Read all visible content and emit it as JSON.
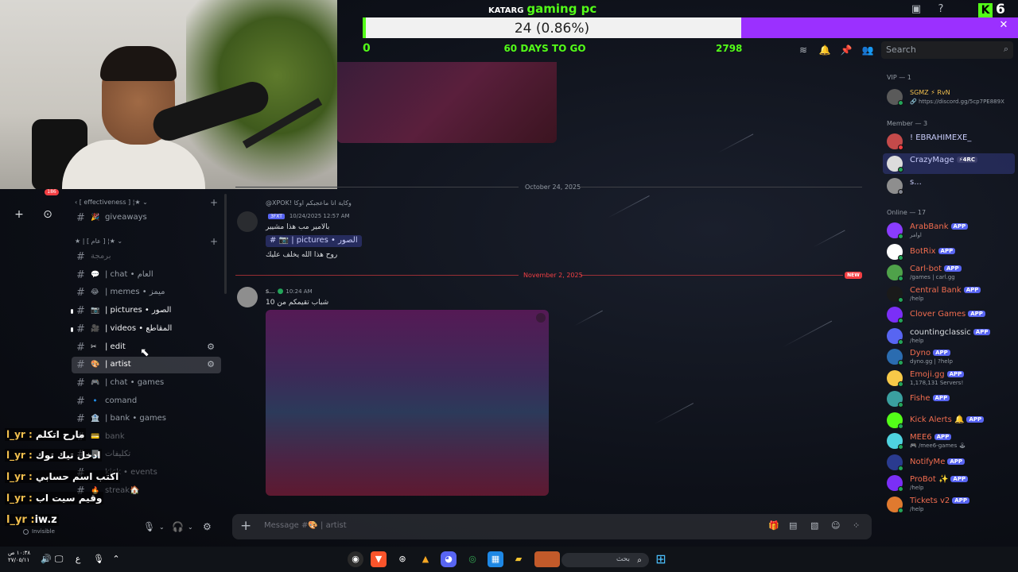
{
  "goal": {
    "brand": "KATARG",
    "title": "gaming pc",
    "bar_text": "24 (0.86%)",
    "progress_fraction": 0.0086,
    "min": "0",
    "days_left": "60 DAYS TO GO",
    "max": "2798",
    "kick_count": "6",
    "kick_logo": "K"
  },
  "header": {
    "search_placeholder": "Search"
  },
  "live_badge": "186",
  "channels": {
    "cat1": "‹ [ effectiveness ] ¦★ ⌄",
    "cat2": "★ | [ عام ] ¦★ ⌄",
    "items": [
      {
        "emoji": "🎉",
        "label": "giveaways"
      },
      {
        "emoji": "",
        "label": "برمجة"
      },
      {
        "emoji": "💬",
        "label": "| chat • العام"
      },
      {
        "emoji": "😂",
        "label": "| memes • ميمز"
      },
      {
        "emoji": "📷",
        "label": "| pictures • الصور"
      },
      {
        "emoji": "🎥",
        "label": "| videos • المقاطع"
      },
      {
        "emoji": "✂",
        "label": "| edit"
      },
      {
        "emoji": "🎨",
        "label": "| artist"
      },
      {
        "emoji": "🎮",
        "label": "| chat • games"
      },
      {
        "emoji": "🔹",
        "label": "comand"
      },
      {
        "emoji": "🏦",
        "label": "| bank • games"
      },
      {
        "emoji": "💳",
        "label": "bank"
      },
      {
        "emoji": "📃",
        "label": "تكليفات"
      },
      {
        "emoji": "",
        "label": "kick • events"
      },
      {
        "emoji": "🔥",
        "label": "streak🏠"
      }
    ]
  },
  "chat_overlay": [
    {
      "user": "l_yr :",
      "msg": "مارح اتكلم"
    },
    {
      "user": "l_yr :",
      "msg": "ادخل تيك توك"
    },
    {
      "user": "l_yr :",
      "msg": "اكتب اسم حسابي"
    },
    {
      "user": "l_yr :",
      "msg": "وقيم سيت اب"
    }
  ],
  "user_panel": {
    "name_user": "l_yr :",
    "name_value": "iw.z",
    "status": "Invisible"
  },
  "messages": {
    "date1": "October 24, 2025",
    "date2": "November 2, 2025",
    "new_label": "NEW",
    "m1_reply": "@XPOK! وكاية انا ماعجبكم اوكا",
    "m1_tag": "3FXT",
    "m1_time": "10/24/2025 12:57 AM",
    "m1_line1": "بالامير مب هذا مشيير",
    "m1_chip": "# 📷 | pictures • الصور",
    "m1_line2": "روح هذا الله يخلف عليك",
    "m2_name": "s...",
    "m2_time": "10:24 AM",
    "m2_text": "شباب تقيمكم من 10"
  },
  "composer": {
    "placeholder": "Message #🎨 | artist"
  },
  "members": {
    "vip_header": "VIP — 1",
    "member_header": "Member — 3",
    "online_header": "Online — 17",
    "vip": [
      {
        "name": "SGMZ ⚡ RvN",
        "sub": "🔗 https://discord.gg/5cp7PE889X",
        "color": "#f2c04e"
      }
    ],
    "member": [
      {
        "name": "! EBRAHIMEXE_",
        "sub": "",
        "color": "#c9cdfb"
      },
      {
        "name": "CrazyMage",
        "badge": "⚡4RC",
        "sub": "",
        "color": "#c9cdfb"
      },
      {
        "name": "s...",
        "sub": "",
        "color": "#c9cdfb"
      }
    ],
    "online": [
      {
        "name": "ArabBank",
        "sub": "اوامر",
        "color": "#f26d4f",
        "av": "#8a3cff"
      },
      {
        "name": "BotRix",
        "sub": "",
        "color": "#f26d4f",
        "av": "#ffffff"
      },
      {
        "name": "Carl-bot",
        "sub": "/games | carl.gg",
        "color": "#f26d4f",
        "av": "#4fa24a"
      },
      {
        "name": "Central Bank",
        "sub": "/help",
        "color": "#f26d4f",
        "av": "#1a1a1a"
      },
      {
        "name": "Clover Games",
        "sub": "",
        "color": "#f26d4f",
        "av": "#7b2ff7"
      },
      {
        "name": "countingclassic",
        "sub": "/help",
        "color": "#dbdee1",
        "av": "#5865f2"
      },
      {
        "name": "Dyno",
        "sub": "dyno.gg | ?help",
        "color": "#f26d4f",
        "av": "#2b6cb0"
      },
      {
        "name": "Emoji.gg",
        "sub": "1,178,131 Servers!",
        "color": "#f26d4f",
        "av": "#f7c948"
      },
      {
        "name": "Fishe",
        "sub": "",
        "color": "#f26d4f",
        "av": "#3aa0a0"
      },
      {
        "name": "Kick Alerts 🔔",
        "sub": "",
        "color": "#f26d4f",
        "av": "#53fc18"
      },
      {
        "name": "MEE6",
        "sub": "🎮 /mee6-games 🕹",
        "color": "#f26d4f",
        "av": "#4fd3e0"
      },
      {
        "name": "NotifyMe",
        "sub": "",
        "color": "#f26d4f",
        "av": "#2a3b8f"
      },
      {
        "name": "ProBot ✨",
        "sub": "/help",
        "color": "#f26d4f",
        "av": "#7b2ff7"
      },
      {
        "name": "Tickets v2",
        "sub": "/help",
        "color": "#f26d4f",
        "av": "#e07a2f"
      }
    ],
    "app_tag": "APP"
  },
  "taskbar": {
    "search": "بحث",
    "time": "١٠:٣٨ ص",
    "date": "٢٧/٠٥/١١",
    "lang": "ع"
  }
}
